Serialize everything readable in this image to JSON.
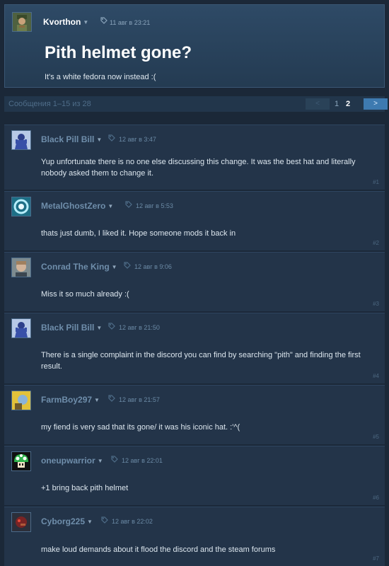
{
  "op": {
    "author": "Kvorthon",
    "date": "11 авг в 23:21",
    "title": "Pith helmet gone?",
    "body": "It's a white fedora now instead :("
  },
  "pager": {
    "count": "Сообщения 1–15 из 28",
    "prev": "<",
    "pages": [
      "1",
      "2"
    ],
    "current": "2",
    "next": ">"
  },
  "posts": [
    {
      "author": "Black Pill Bill",
      "date": "12 авг в 3:47",
      "text": "Yup unfortunate there is no one else discussing this change. It was the best hat and literally nobody asked them to change it.",
      "num": "#1",
      "avatar": "blue-figure-icon"
    },
    {
      "author": "MetalGhostZero",
      "date": "12 авг в 5:53",
      "text": "thats just dumb, I liked it. Hope someone mods it back in",
      "num": "#2",
      "avatar": "blue-ring-icon"
    },
    {
      "author": "Conrad The King",
      "date": "12 авг в 9:06",
      "text": "Miss it so much already :(",
      "num": "#3",
      "avatar": "face-photo-icon"
    },
    {
      "author": "Black Pill Bill",
      "date": "12 авг в 21:50",
      "text": "There is a single complaint in the discord you can find by searching \"pith\" and finding the first result.",
      "num": "#4",
      "avatar": "blue-figure-icon"
    },
    {
      "author": "FarmBoy297",
      "date": "12 авг в 21:57",
      "text": "my fiend is very sad that its gone/ it was his iconic hat. :'^(",
      "num": "#5",
      "avatar": "yellow-cartoon-icon"
    },
    {
      "author": "oneupwarrior",
      "date": "12 авг в 22:01",
      "text": "+1 bring back pith helmet",
      "num": "#6",
      "avatar": "green-mushroom-icon"
    },
    {
      "author": "Cyborg225",
      "date": "12 авг в 22:02",
      "text": "make loud demands about it flood the discord and the steam forums",
      "num": "#7",
      "avatar": "red-cyborg-icon"
    }
  ],
  "colors": {
    "background": "#1b2838",
    "post_background": "#233449",
    "accent": "#3e7ab0",
    "author_muted": "#6f8eab"
  }
}
